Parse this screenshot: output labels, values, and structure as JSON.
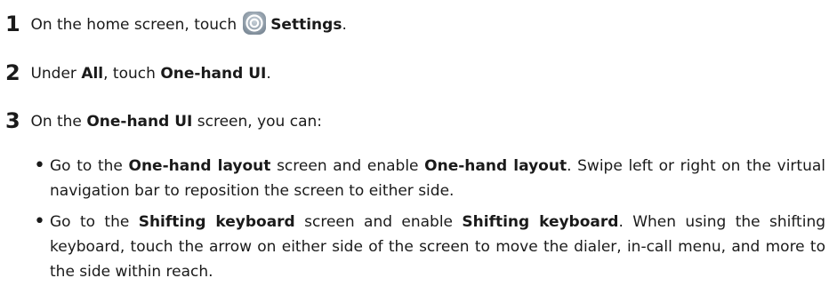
{
  "steps": [
    {
      "number": "1",
      "parts": [
        "On the home screen, touch",
        "Settings",
        "."
      ]
    },
    {
      "number": "2",
      "parts": [
        "Under",
        "All",
        ", touch",
        "One-hand UI",
        "."
      ]
    },
    {
      "number": "3",
      "parts": [
        "On the",
        "One-hand UI",
        "screen, you can:"
      ]
    }
  ],
  "bullets": [
    {
      "parts": [
        "Go to the",
        "One-hand layout",
        "screen and enable",
        "One-hand layout",
        ". Swipe left or right on the virtual navigation bar to reposition the screen to either side."
      ]
    },
    {
      "parts": [
        "Go to the",
        "Shifting keyboard",
        "screen and enable",
        "Shifting keyboard",
        ". When using the shifting keyboard, touch the arrow on either side of the screen to move the dialer, in-call menu, and more to the side within reach."
      ]
    }
  ],
  "icons": {
    "settings": "settings-gear-icon",
    "settings_icon_color": "#8a99a8"
  },
  "bullet_char": "•"
}
